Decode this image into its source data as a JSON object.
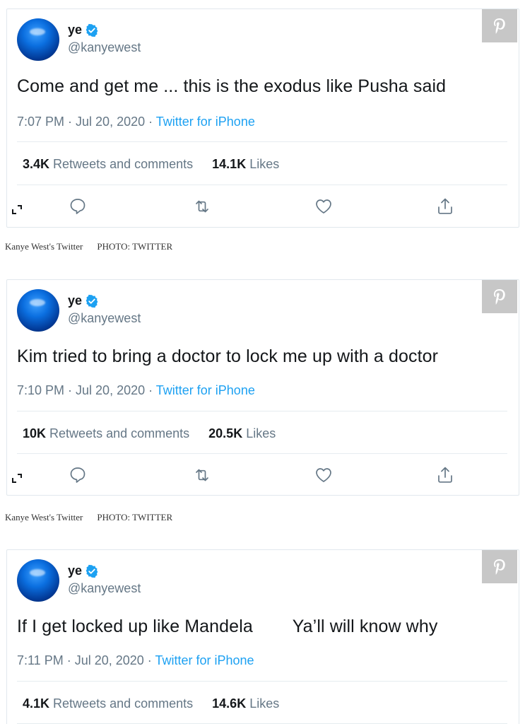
{
  "colors": {
    "link": "#1da1f2",
    "muted": "#657786",
    "text": "#14171a",
    "pin_bg": "#c7c7c7"
  },
  "tweets": [
    {
      "name": "ye",
      "handle": "@kanyewest",
      "text": "Come and get me ... this is the exodus like Pusha said",
      "time": "7:07 PM · Jul 20, 2020 · ",
      "source": "Twitter for iPhone",
      "retweets": "3.4K",
      "retweets_label": "Retweets and comments",
      "likes": "14.1K",
      "likes_label": "Likes"
    },
    {
      "name": "ye",
      "handle": "@kanyewest",
      "text": "Kim tried to bring a doctor to lock me up with a doctor",
      "time": "7:10 PM · Jul 20, 2020 · ",
      "source": "Twitter for iPhone",
      "retweets": "10K",
      "retweets_label": "Retweets and comments",
      "likes": "20.5K",
      "likes_label": "Likes"
    },
    {
      "name": "ye",
      "handle": "@kanyewest",
      "text": "If I get locked up like Mandela        Ya’ll will know why",
      "time": "7:11 PM · Jul 20, 2020 · ",
      "source": "Twitter for iPhone",
      "retweets": "4.1K",
      "retweets_label": "Retweets and comments",
      "likes": "14.6K",
      "likes_label": "Likes"
    }
  ],
  "captions": [
    {
      "text": "Kanye West's Twitter",
      "credit": "PHOTO: TWITTER"
    },
    {
      "text": "Kanye West's Twitter",
      "credit": "PHOTO: TWITTER"
    }
  ],
  "icons": {
    "pin": "pinterest-icon",
    "verified": "verified-badge-icon",
    "reply": "reply-icon",
    "retweet": "retweet-icon",
    "like": "heart-icon",
    "share": "share-icon",
    "expand": "expand-icon"
  }
}
